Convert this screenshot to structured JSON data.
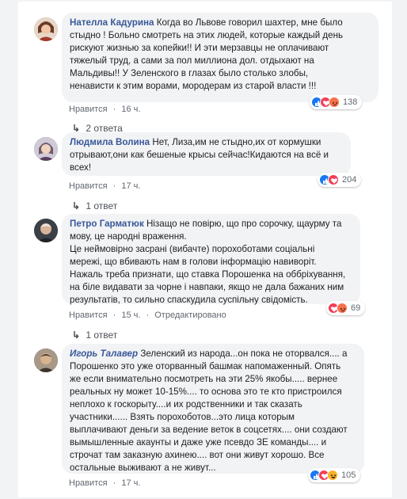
{
  "comments": [
    {
      "author": "Нателла Кадурина",
      "text": "Когда во Львове говорил шахтер, мне было\nстыдно ! Больно смотреть на этих людей, которые каждый день\nрискуют жизнью за копейки!! И эти мерзавцы не оплачивают\nтяжелый труд, а сами за пол миллиона дол. отдыхают на\nМальдивы!! У Зеленского в глазах было столько злобы,\nненависти к этим ворами, мородерам из старой власти !!!",
      "like_label": "Нравится",
      "time": "16 ч.",
      "reaction_count": "138",
      "replies": "2 ответа",
      "reactions": [
        "like",
        "love",
        "angry"
      ],
      "avatar_color": "#9b6b4a"
    },
    {
      "author": "Людмила Волина",
      "text": "Нет, Лиза,им не стыдно,их от кормушки\nотрывают,они как бешеные крысы сейчас!Кидаются на всё и\nвсех!",
      "like_label": "Нравится",
      "time": "17 ч.",
      "reaction_count": "204",
      "replies": "1 ответ",
      "reactions": [
        "like",
        "love"
      ],
      "avatar_color": "#8a7d8f"
    },
    {
      "author": "Петро Гарматюк",
      "text": "Нізащо не повірю, що про сорочку, щаурму та\nмову, це народні враження.\nЦе неймовірно засрані (вибачте) порохоботами соціальні\nмережі, що вбивають нам в голови інформацію навиворіт.\nНажаль треба признати, що ставка Порошенка на оббріхування,\nна біле видавати за чорне і навпаки, якщо не дала бажаних ним\nрезультатів, то сильно спаскудила суспільну свідомість.",
      "like_label": "Нравится",
      "time": "15 ч.",
      "edited": "Отредактировано",
      "reaction_count": "69",
      "replies": "1 ответ",
      "reactions": [
        "love",
        "angry"
      ],
      "avatar_color": "#3d3a36"
    },
    {
      "author": "Игорь Талавер",
      "text": "Зеленский из народа...он пока не оторвался.... а\nПорошенко это уже оторванный башмак напомаженный. Опять\nже если внимательно посмотреть на эти 25% якобы..... вернее\nреальных ну может 10-15%.... то основа это те кто пристроился\nнеплохо к госкорыту....и их родственники и так сказать\nучастники...... Взять порохоботов...это лица которым\nвыплачивают деньги за ведение веток в соцсетях.... они создают\nвымышленные акаунты и даже уже псевдо ЗЕ команды.... и\nстрочат там заказную ахинею.... вот они живут хорошо. Все\nостальные выживают а не живут...",
      "like_label": "Нравится",
      "time": "17 ч.",
      "reaction_count": "105",
      "reactions": [
        "like",
        "love",
        "haha"
      ],
      "avatar_color": "#6e5a4c"
    }
  ],
  "colors": {
    "author": "#385898",
    "bubble": "#f2f3f5",
    "meta": "#606770"
  }
}
